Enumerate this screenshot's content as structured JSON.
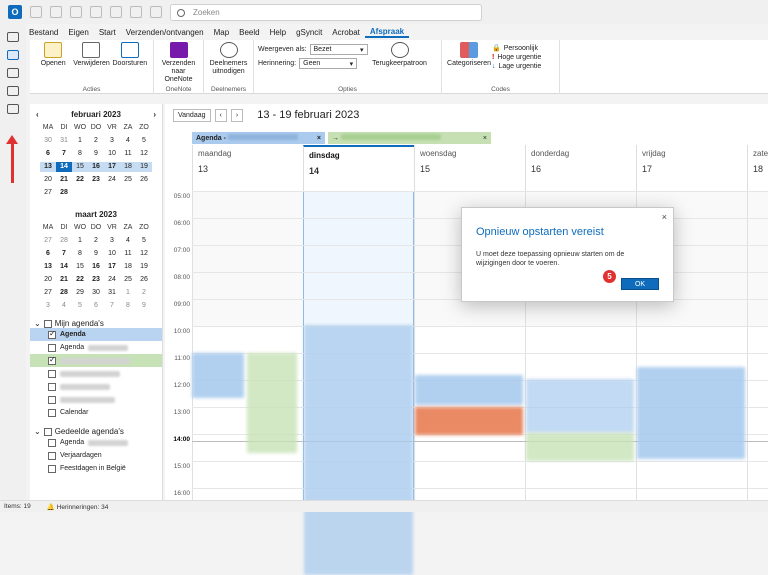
{
  "app": {
    "icon_letter": "O",
    "search_placeholder": "Zoeken"
  },
  "menu": [
    "Bestand",
    "Eigen",
    "Start",
    "Verzenden/ontvangen",
    "Map",
    "Beeld",
    "Help",
    "gSyncit",
    "Acrobat",
    "Afspraak"
  ],
  "menu_active": "Afspraak",
  "ribbon": {
    "acties": {
      "label": "Acties",
      "openen": "Openen",
      "verwijderen": "Verwijderen",
      "doorsturen": "Doorsturen"
    },
    "onenote": {
      "label": "OneNote",
      "verzenden": "Verzenden naar OneNote"
    },
    "deelnemers": {
      "label": "Deelnemers",
      "uitnodigen": "Deelnemers uitnodigen"
    },
    "opties": {
      "label": "Opties",
      "weergeven": "Weergeven als:",
      "weergeven_value": "Bezet",
      "herinnering": "Herinnering:",
      "herinnering_value": "Geen",
      "terugkeer": "Terugkeerpatroon"
    },
    "codes": {
      "label": "Codes",
      "categoriseren": "Categoriseren",
      "persoonlijk": "Persoonlijk",
      "hoge": "Hoge urgentie",
      "lage": "Lage urgentie"
    }
  },
  "calendar1": {
    "title": "februari 2023",
    "days": [
      "MA",
      "DI",
      "WO",
      "DO",
      "VR",
      "ZA",
      "ZO"
    ],
    "weeks": [
      [
        "30",
        "31",
        "1",
        "2",
        "3",
        "4",
        "5"
      ],
      [
        "6",
        "7",
        "8",
        "9",
        "10",
        "11",
        "12"
      ],
      [
        "13",
        "14",
        "15",
        "16",
        "17",
        "18",
        "19"
      ],
      [
        "20",
        "21",
        "22",
        "23",
        "24",
        "25",
        "26"
      ],
      [
        "27",
        "28",
        "",
        "",
        "",
        "",
        ""
      ]
    ]
  },
  "calendar2": {
    "title": "maart 2023",
    "days": [
      "MA",
      "DI",
      "WO",
      "DO",
      "VR",
      "ZA",
      "ZO"
    ],
    "weeks": [
      [
        "27",
        "28",
        "1",
        "2",
        "3",
        "4",
        "5"
      ],
      [
        "6",
        "7",
        "8",
        "9",
        "10",
        "11",
        "12"
      ],
      [
        "13",
        "14",
        "15",
        "16",
        "17",
        "18",
        "19"
      ],
      [
        "20",
        "21",
        "22",
        "23",
        "24",
        "25",
        "26"
      ],
      [
        "27",
        "28",
        "29",
        "30",
        "31",
        "1",
        "2"
      ],
      [
        "3",
        "4",
        "5",
        "6",
        "7",
        "8",
        "9"
      ]
    ]
  },
  "folders": {
    "mijn": "Mijn agenda's",
    "mijn_items": [
      "Agenda",
      "Agenda",
      "",
      "",
      "",
      "",
      "Calendar"
    ],
    "gedeeld": "Gedeelde agenda's",
    "gedeeld_items": [
      "Agenda",
      "Verjaardagen",
      "Feestdagen in België"
    ]
  },
  "nav": {
    "today": "Vandaag",
    "prev": "‹",
    "next": "›",
    "range": "13 - 19 februari 2023"
  },
  "tabs": {
    "agenda": "Agenda -",
    "close": "×",
    "arrow": "→"
  },
  "days": [
    {
      "name": "maandag",
      "num": "13"
    },
    {
      "name": "dinsdag",
      "num": "14"
    },
    {
      "name": "woensdag",
      "num": "15"
    },
    {
      "name": "donderdag",
      "num": "16"
    },
    {
      "name": "vrijdag",
      "num": "17"
    },
    {
      "name": "zate",
      "num": "18"
    }
  ],
  "times": [
    "05:00",
    "06:00",
    "07:00",
    "08:00",
    "09:00",
    "10:00",
    "11:00",
    "12:00",
    "13:00",
    "14:00",
    "15:00",
    "16:00"
  ],
  "dialog": {
    "title": "Opnieuw opstarten vereist",
    "close": "×",
    "message": "U moet deze toepassing opnieuw starten om de wijzigingen door te voeren.",
    "ok": "OK"
  },
  "badge": "5",
  "status": {
    "items": "Items: 19",
    "reminders": "Herinneringen: 34"
  },
  "colors": {
    "accent": "#0f6cbd",
    "event_blue": "#a9cbee",
    "event_green": "#c7e2b6",
    "event_orange": "#e8845c",
    "marker": "#e03030"
  }
}
